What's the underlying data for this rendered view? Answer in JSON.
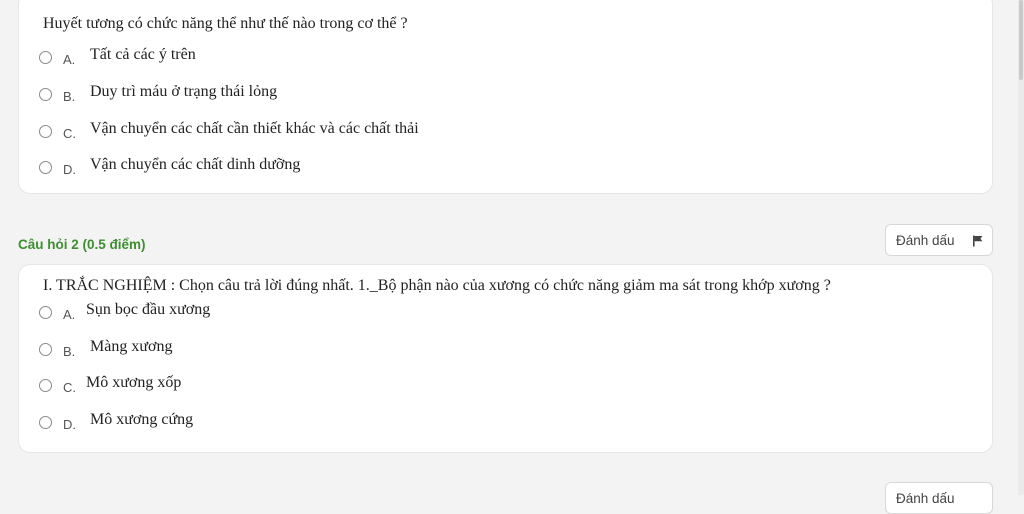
{
  "question1": {
    "text": "Huyết tương có chức năng thể như thế nào trong cơ thể ?",
    "options": [
      {
        "letter": "A.",
        "text": "Tất cả các ý trên"
      },
      {
        "letter": "B.",
        "text": "Duy trì máu ở trạng thái lỏng"
      },
      {
        "letter": "C.",
        "text": "Vận chuyển các chất cần thiết khác và các chất thải"
      },
      {
        "letter": "D.",
        "text": "Vận chuyển các chất dinh dưỡng"
      }
    ]
  },
  "question2": {
    "header": "Câu hỏi 2 (0.5 điểm)",
    "flag_label": "Đánh dấu",
    "text": "I. TRẮC NGHIỆM : Chọn câu trả lời đúng nhất. 1._Bộ phận nào của xương có chức năng giảm ma sát trong khớp xương ?",
    "options": [
      {
        "letter": "A.",
        "text": "Sụn bọc đầu xương"
      },
      {
        "letter": "B.",
        "text": "Màng xương"
      },
      {
        "letter": "C.",
        "text": "Mô xương xốp"
      },
      {
        "letter": "D.",
        "text": "Mô xương cứng"
      }
    ]
  },
  "question3": {
    "flag_label": "Đánh dấu"
  },
  "colors": {
    "header_green": "#3d8f2f",
    "background": "#f3f3f3"
  }
}
